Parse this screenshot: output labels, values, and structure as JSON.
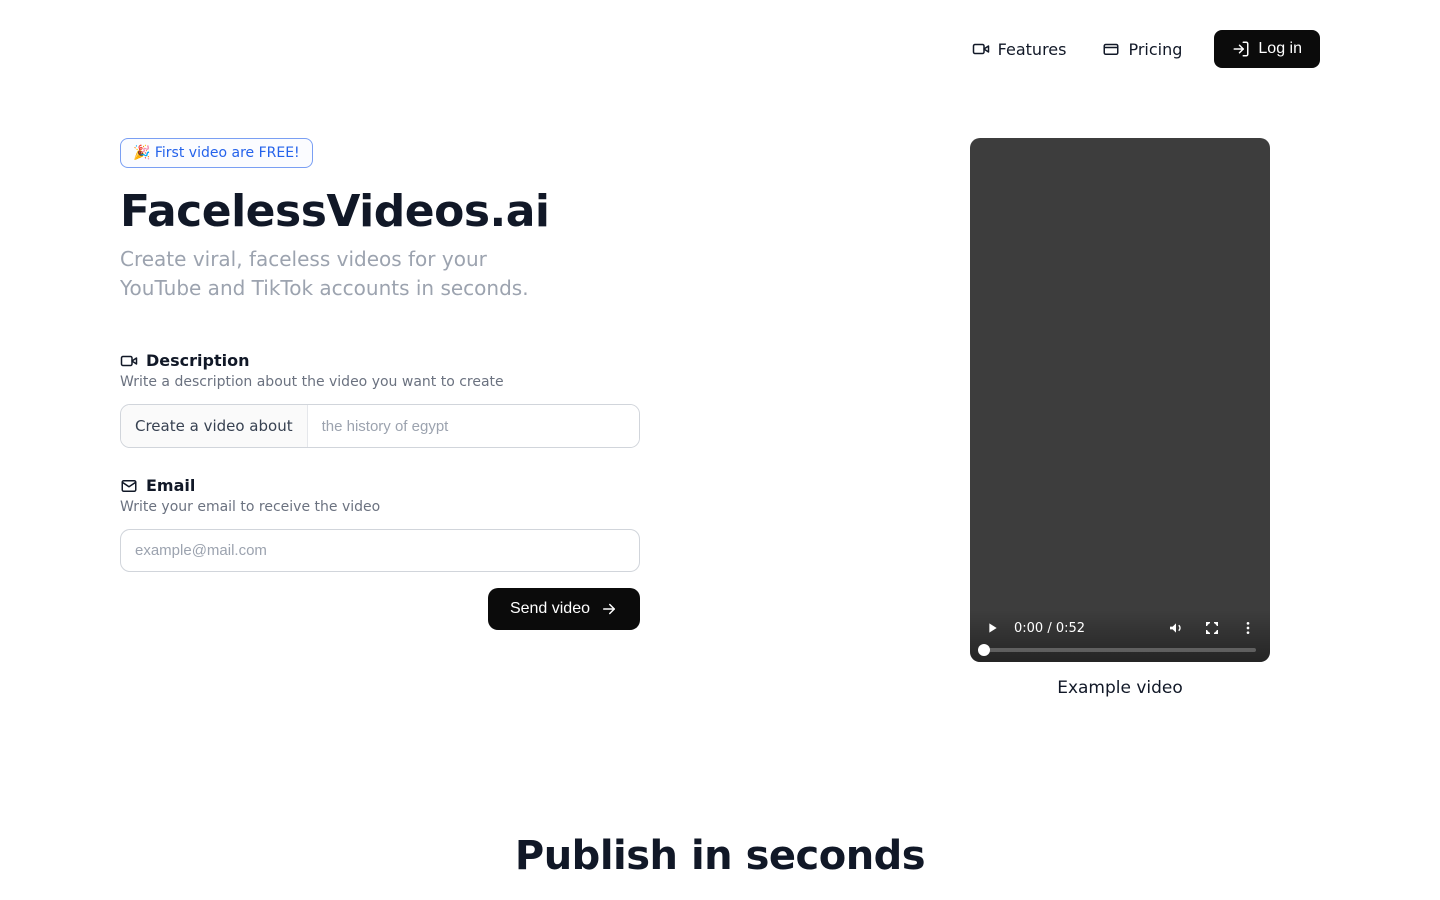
{
  "nav": {
    "features": "Features",
    "pricing": "Pricing",
    "login": "Log in"
  },
  "hero": {
    "promo": "🎉 First video are FREE!",
    "brand": "FacelessVideos.ai",
    "subtitle": "Create viral, faceless videos for your YouTube and TikTok accounts in seconds."
  },
  "form": {
    "description": {
      "label": "Description",
      "help": "Write a description about the video you want to create",
      "prefix": "Create a video about",
      "placeholder": "the history of egypt"
    },
    "email": {
      "label": "Email",
      "help": "Write your email to receive the video",
      "placeholder": "example@mail.com"
    },
    "submit": "Send video"
  },
  "video": {
    "time": "0:00 / 0:52",
    "caption": "Example video"
  },
  "section2": {
    "headline": "Publish in seconds"
  }
}
